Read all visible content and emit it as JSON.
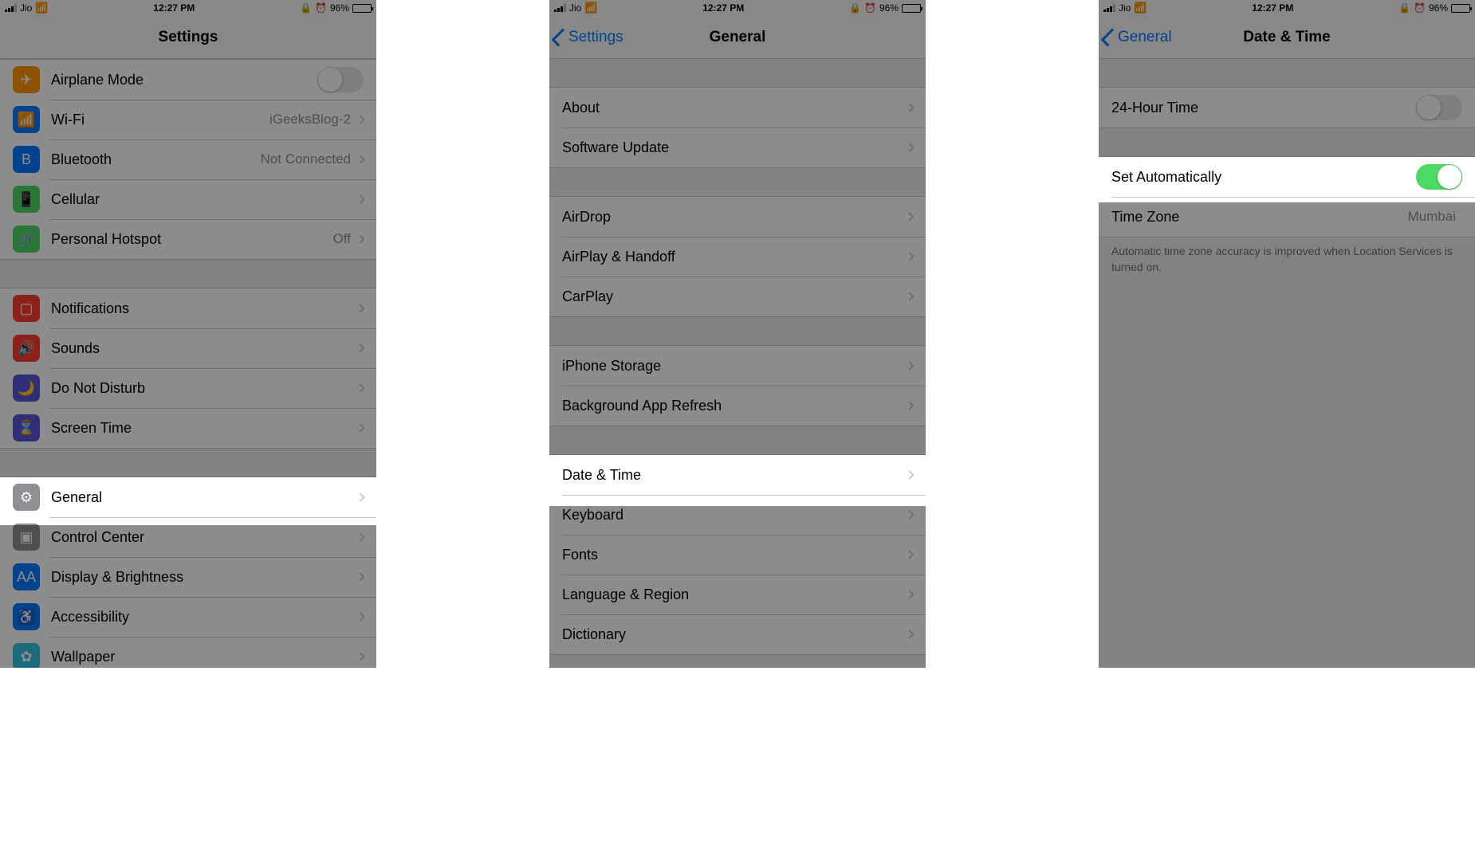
{
  "status": {
    "carrier": "Jio",
    "time": "12:27 PM",
    "battery": "96%"
  },
  "screen1": {
    "title": "Settings",
    "rows": {
      "airplane": "Airplane Mode",
      "wifi": "Wi-Fi",
      "wifi_value": "iGeeksBlog-2",
      "bluetooth": "Bluetooth",
      "bluetooth_value": "Not Connected",
      "cellular": "Cellular",
      "hotspot": "Personal Hotspot",
      "hotspot_value": "Off",
      "notifications": "Notifications",
      "sounds": "Sounds",
      "dnd": "Do Not Disturb",
      "screentime": "Screen Time",
      "general": "General",
      "control": "Control Center",
      "display": "Display & Brightness",
      "accessibility": "Accessibility",
      "wallpaper": "Wallpaper"
    }
  },
  "screen2": {
    "back": "Settings",
    "title": "General",
    "rows": {
      "about": "About",
      "software": "Software Update",
      "airdrop": "AirDrop",
      "airplay": "AirPlay & Handoff",
      "carplay": "CarPlay",
      "storage": "iPhone Storage",
      "refresh": "Background App Refresh",
      "datetime": "Date & Time",
      "keyboard": "Keyboard",
      "fonts": "Fonts",
      "language": "Language & Region",
      "dictionary": "Dictionary"
    }
  },
  "screen3": {
    "back": "General",
    "title": "Date & Time",
    "rows": {
      "h24": "24-Hour Time",
      "setauto": "Set Automatically",
      "tz": "Time Zone",
      "tz_value": "Mumbai"
    },
    "footer": "Automatic time zone accuracy is improved when Location Services is turned on."
  }
}
